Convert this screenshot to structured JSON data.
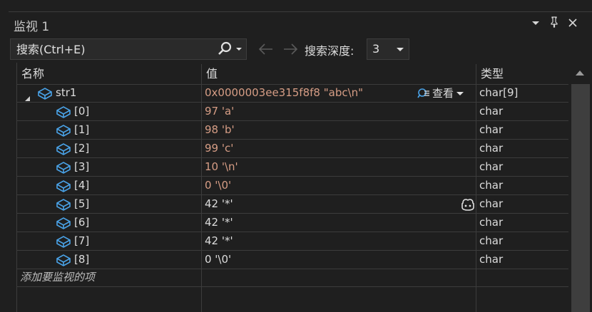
{
  "window": {
    "title": "监视 1"
  },
  "toolbar": {
    "search_placeholder": "搜索(Ctrl+E)",
    "depth_label": "搜索深度:",
    "depth_value": "3"
  },
  "columns": {
    "name": "名称",
    "value": "值",
    "type": "类型"
  },
  "rows": [
    {
      "name": "str1",
      "value": "0x0000003ee315f8f8 \"abc\\n\"",
      "type": "char[9]",
      "changed": true
    },
    {
      "name": "[0]",
      "value": "97 'a'",
      "type": "char",
      "changed": true
    },
    {
      "name": "[1]",
      "value": "98 'b'",
      "type": "char",
      "changed": true
    },
    {
      "name": "[2]",
      "value": "99 'c'",
      "type": "char",
      "changed": true
    },
    {
      "name": "[3]",
      "value": "10 '\\n'",
      "type": "char",
      "changed": true
    },
    {
      "name": "[4]",
      "value": "0 '\\0'",
      "type": "char",
      "changed": true
    },
    {
      "name": "[5]",
      "value": "42 '*'",
      "type": "char",
      "changed": false
    },
    {
      "name": "[6]",
      "value": "42 '*'",
      "type": "char",
      "changed": false
    },
    {
      "name": "[7]",
      "value": "42 '*'",
      "type": "char",
      "changed": false
    },
    {
      "name": "[8]",
      "value": "0 '\\0'",
      "type": "char",
      "changed": false
    }
  ],
  "viewer_label": "查看",
  "add_item_placeholder": "添加要监视的项",
  "colors": {
    "changed_value": "#d69d85",
    "icon_blue": "#4aa3e8",
    "background": "#1f1f1f"
  }
}
